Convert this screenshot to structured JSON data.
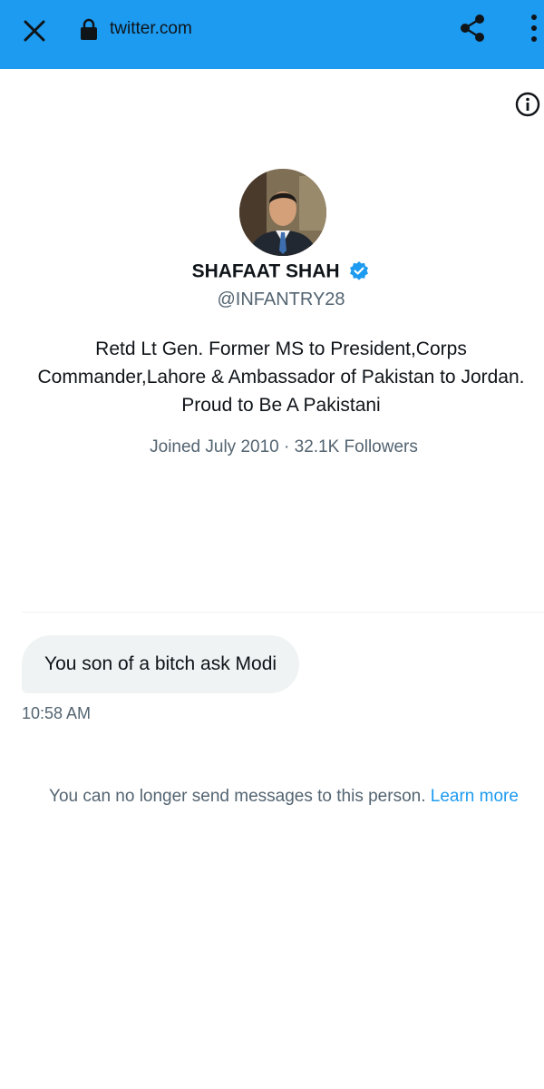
{
  "browser": {
    "url": "twitter.com",
    "icons": [
      "close-icon",
      "lock-icon",
      "share-icon",
      "more-vertical-icon"
    ]
  },
  "profile": {
    "name": "SHAFAAT SHAH",
    "handle": "@INFANTRY28",
    "verified": true,
    "bio": "Retd Lt Gen. Former MS to President,Corps Commander,Lahore & Ambassador of Pakistan to Jordan. Proud to Be A Pakistani",
    "joined": "Joined July 2010",
    "separator": "·",
    "followers": "32.1K Followers"
  },
  "conversation": {
    "messages": [
      {
        "text": "You son of a bitch ask Modi",
        "time": "10:58 AM"
      }
    ],
    "notice": "You can no longer send messages to this person.",
    "notice_link": "Learn more"
  },
  "colors": {
    "accent": "#1d9bf0",
    "text": "#0f1419",
    "secondary_text": "#536471",
    "bubble_bg": "#eff3f4"
  }
}
